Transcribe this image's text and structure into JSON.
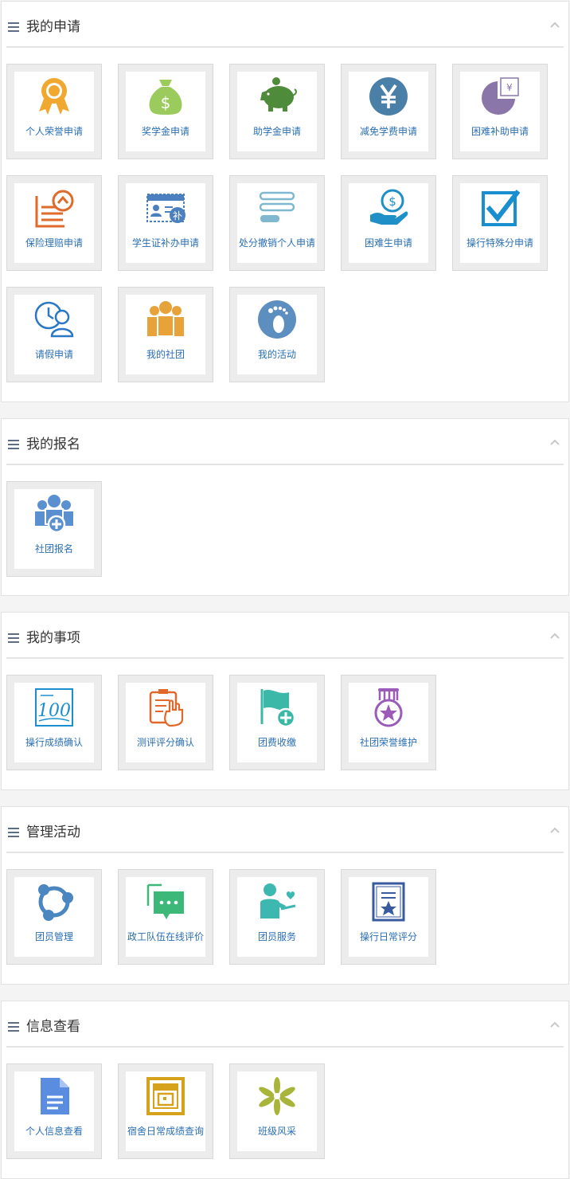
{
  "sections": [
    {
      "title": "我的申请",
      "items": [
        {
          "label": "个人荣誉申请",
          "icon": "medal-icon",
          "color": "#f0a830"
        },
        {
          "label": "奖学金申请",
          "icon": "money-bag-icon",
          "color": "#9acb5c"
        },
        {
          "label": "助学金申请",
          "icon": "piggy-bank-icon",
          "color": "#4e8b3a"
        },
        {
          "label": "减免学费申请",
          "icon": "yen-coin-icon",
          "color": "#4a7fa8"
        },
        {
          "label": "困难补助申请",
          "icon": "pie-chart-icon",
          "color": "#8a76a8"
        },
        {
          "label": "保险理赔申请",
          "icon": "insurance-doc-icon",
          "color": "#e06a2a"
        },
        {
          "label": "学生证补办申请",
          "icon": "student-card-icon",
          "color": "#4a7fc0"
        },
        {
          "label": "处分撤销个人申请",
          "icon": "list-lines-icon",
          "color": "#7fb8cf"
        },
        {
          "label": "困难生申请",
          "icon": "hand-coin-icon",
          "color": "#1f8fc8"
        },
        {
          "label": "操行特殊分申请",
          "icon": "checkbox-icon",
          "color": "#1a8fd0"
        },
        {
          "label": "请假申请",
          "icon": "user-clock-icon",
          "color": "#2a77c4"
        },
        {
          "label": "我的社团",
          "icon": "group-icon",
          "color": "#e8a23a"
        },
        {
          "label": "我的活动",
          "icon": "footprint-icon",
          "color": "#5c8fbf"
        }
      ]
    },
    {
      "title": "我的报名",
      "items": [
        {
          "label": "社团报名",
          "icon": "group-add-icon",
          "color": "#5a8fd0"
        }
      ]
    },
    {
      "title": "我的事项",
      "items": [
        {
          "label": "操行成绩确认",
          "icon": "score-100-icon",
          "color": "#1a8fd0"
        },
        {
          "label": "测评评分确认",
          "icon": "clipboard-hand-icon",
          "color": "#e0682a"
        },
        {
          "label": "团费收缴",
          "icon": "flag-add-icon",
          "color": "#3cb8a8"
        },
        {
          "label": "社团荣誉维护",
          "icon": "star-medal-icon",
          "color": "#9a5cb8"
        }
      ]
    },
    {
      "title": "管理活动",
      "items": [
        {
          "label": "团员管理",
          "icon": "network-icon",
          "color": "#4a86c0"
        },
        {
          "label": "政工队伍在线评价",
          "icon": "chat-bubble-icon",
          "color": "#3cb878"
        },
        {
          "label": "团员服务",
          "icon": "person-heart-icon",
          "color": "#3cb8b0"
        },
        {
          "label": "操行日常评分",
          "icon": "star-certificate-icon",
          "color": "#3a5aa0"
        }
      ]
    },
    {
      "title": "信息查看",
      "items": [
        {
          "label": "个人信息查看",
          "icon": "document-icon",
          "color": "#5a8de0"
        },
        {
          "label": "宿舍日常成绩查询",
          "icon": "frame-box-icon",
          "color": "#d6a21c"
        },
        {
          "label": "班级风采",
          "icon": "flower-icon",
          "color": "#a8b43a"
        }
      ]
    }
  ]
}
